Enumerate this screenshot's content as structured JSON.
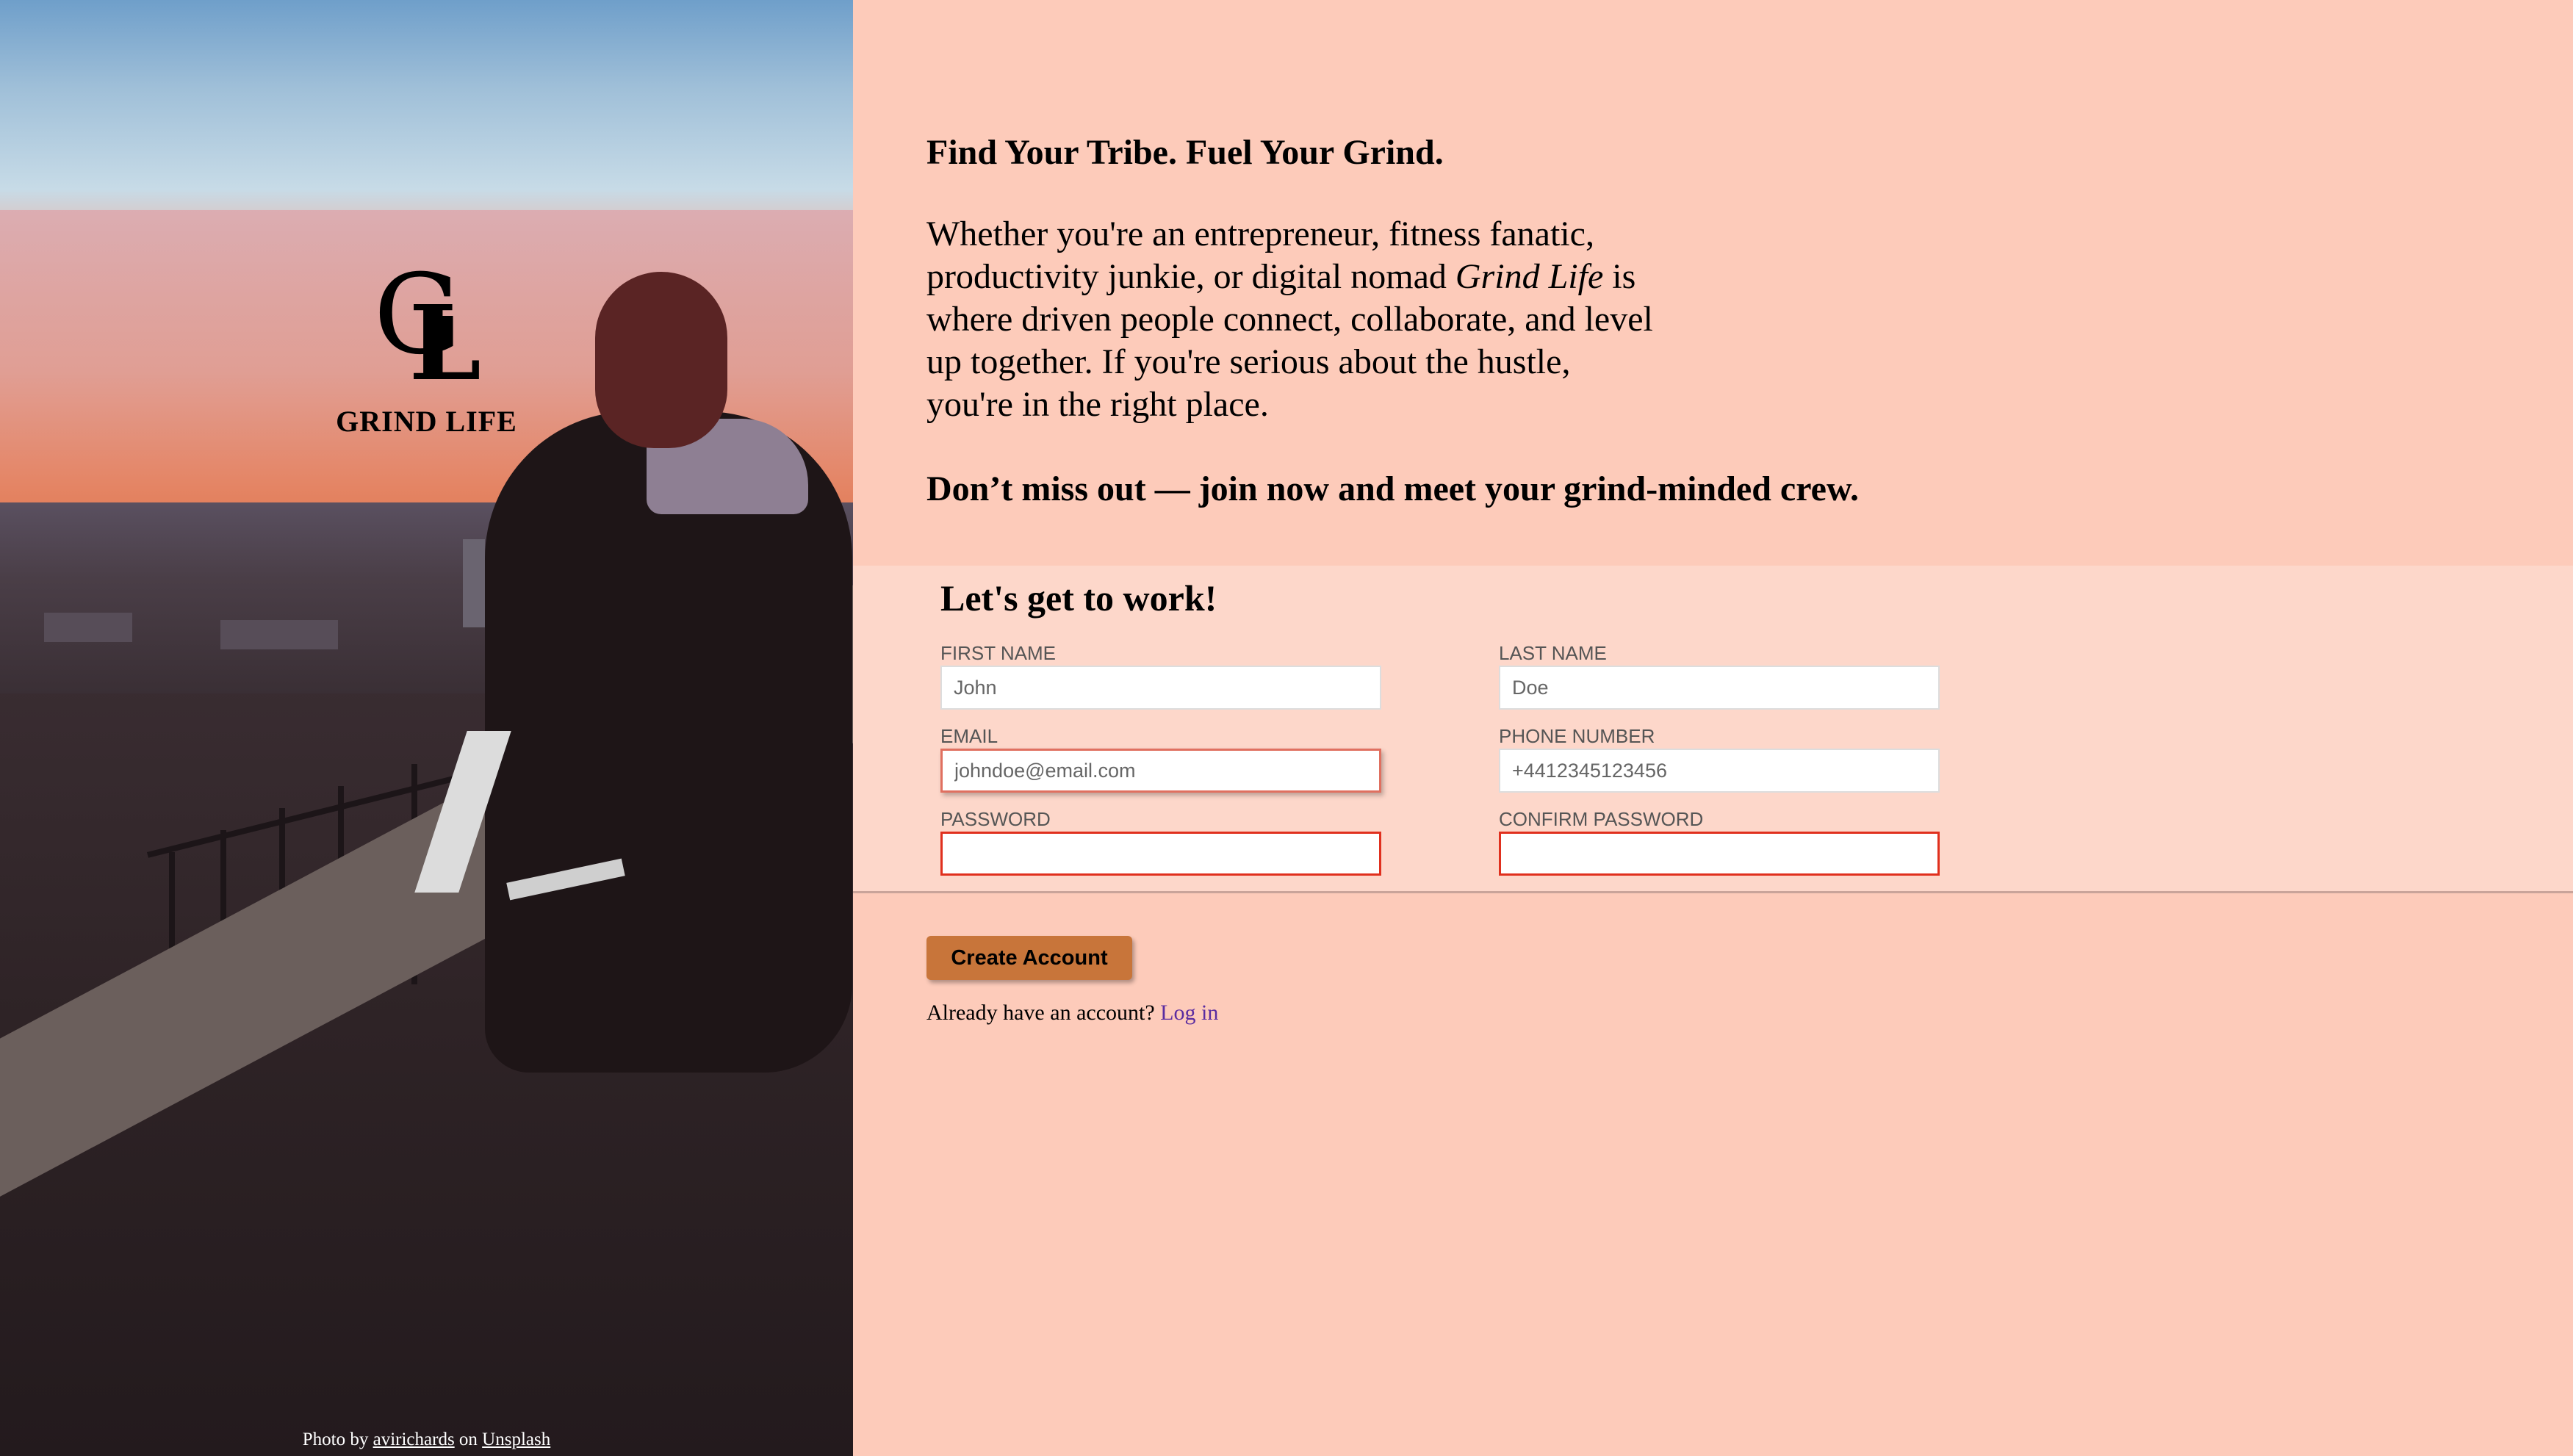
{
  "brand": {
    "monogram_first": "G",
    "monogram_second": "L",
    "name": "GRIND LIFE"
  },
  "credit": {
    "prefix": "Photo by",
    "author": "avirichards",
    "middle": "on",
    "source": "Unsplash"
  },
  "intro": {
    "headline": "Find Your Tribe. Fuel Your Grind.",
    "pitch_before": "Whether you're an entrepreneur, fitness fanatic, productivity junkie, or digital nomad ",
    "pitch_emphasis": "Grind Life",
    "pitch_after": " is where driven people connect, collaborate, and level up together. If you're serious about the hustle, you're in the right place.",
    "cta": "Don’t miss out — join now and meet your grind-minded crew."
  },
  "form": {
    "title": "Let's get to work!",
    "first_name": {
      "label": "FIRST NAME",
      "placeholder": "John"
    },
    "last_name": {
      "label": "LAST NAME",
      "placeholder": "Doe"
    },
    "email": {
      "label": "EMAIL",
      "placeholder": "johndoe@email.com"
    },
    "phone": {
      "label": "PHONE NUMBER",
      "placeholder": "+4412345123456"
    },
    "password": {
      "label": "PASSWORD",
      "placeholder": ""
    },
    "confirm_password": {
      "label": "CONFIRM PASSWORD",
      "placeholder": ""
    },
    "submit_label": "Create Account"
  },
  "login": {
    "prompt": "Already have an account?",
    "link": "Log in"
  },
  "colors": {
    "page_background": "#fdcbba",
    "form_background": "#fdd7ca",
    "button": "#c8753a",
    "invalid_border": "#e0301e",
    "link": "#5a2ca0"
  }
}
